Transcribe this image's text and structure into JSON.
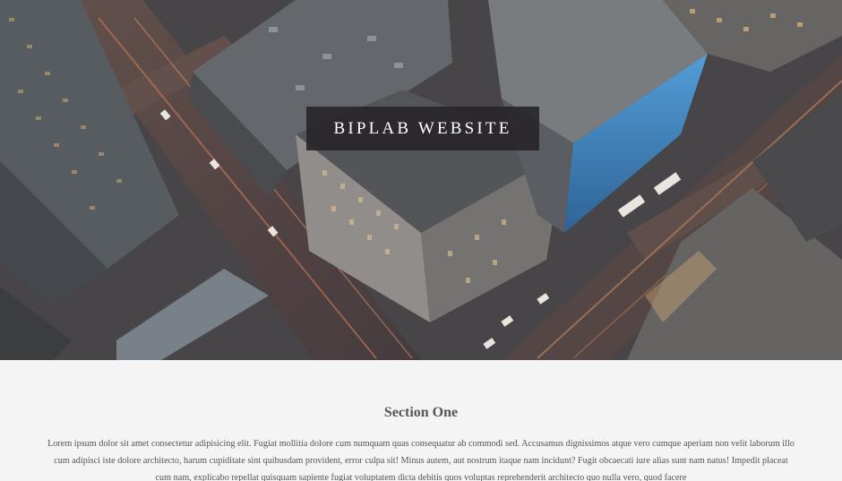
{
  "hero": {
    "title": "BIPLAB WEBSITE"
  },
  "section_one": {
    "heading": "Section One",
    "body": "Lorem ipsum dolor sit amet consectetur adipisicing elit. Fugiat mollitia dolore cum numquam quas consequatur ab commodi sed. Accusamus dignissimos atque vero cumque aperiam non velit laborum illo cum adipisci iste dolore architecto, harum cupiditate sint quibusdam provident, error culpa sit! Minus autem, aut nostrum itaque nam incidunt? Fugit obcaecati iure alias sunt nam natus! Impedit placeat cum nam, explicabo repellat quisquam sapiente fugiat voluptatem dicta debitis quos voluptas reprehenderit architecto quo nulla vero, quod facere"
  },
  "colors": {
    "page_background": "#f4f4f4",
    "title_box": "#282628",
    "text": "#555555",
    "street_light": "#d98c5a",
    "neon_blue": "#3d8fe0"
  }
}
